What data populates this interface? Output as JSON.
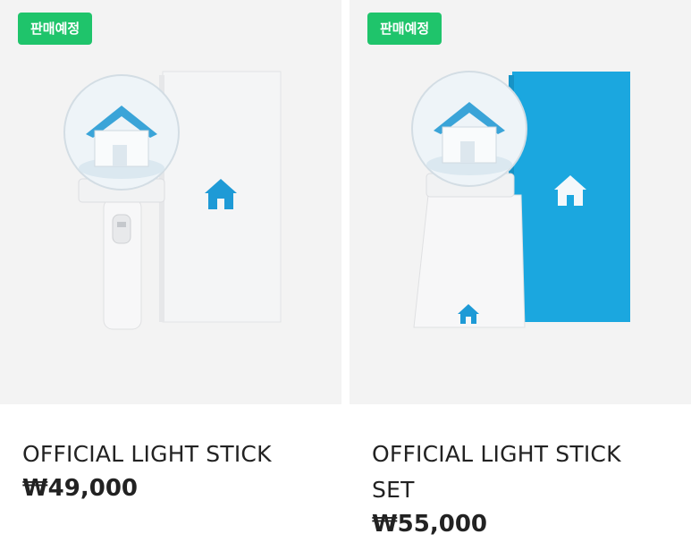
{
  "products": [
    {
      "badge": "판매예정",
      "name": "OFFICIAL LIGHT STICK",
      "price": "₩49,000",
      "box_color": "#f4f5f6",
      "accent_color": "#1e9ad6"
    },
    {
      "badge": "판매예정",
      "name": "OFFICIAL LIGHT STICK SET",
      "price": "₩55,000",
      "box_color": "#1ba7df",
      "accent_color": "#1e9ad6"
    }
  ],
  "colors": {
    "badge_bg": "#1fc46b",
    "image_bg": "#f3f3f3",
    "text": "#222222"
  }
}
